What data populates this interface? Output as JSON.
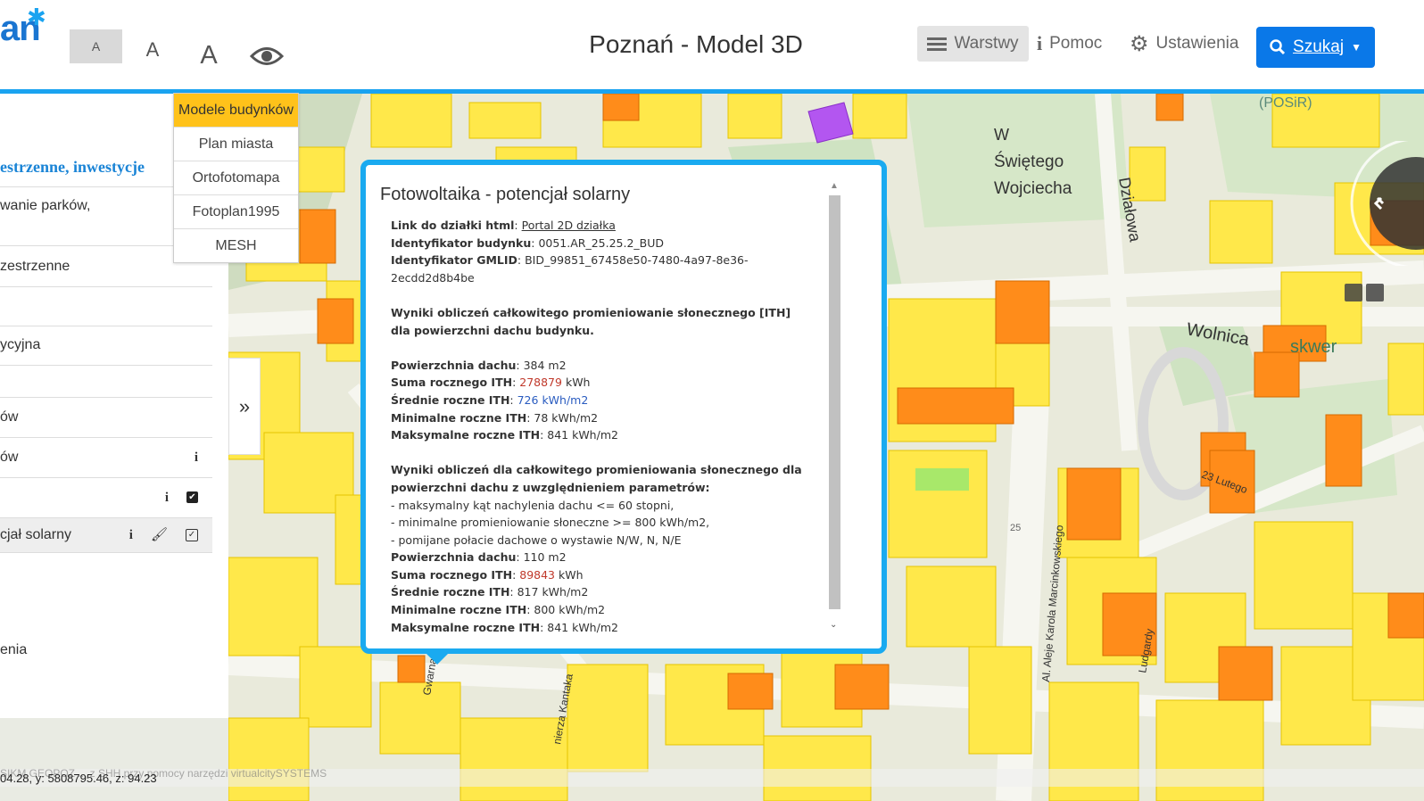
{
  "header": {
    "logo_text": "an",
    "font_small": "A",
    "font_medium": "A",
    "font_large": "A",
    "title": "Poznań - Model 3D",
    "layers_label": "Warstwy",
    "help_label": "Pomoc",
    "settings_label": "Ustawienia",
    "search_label": "Szukaj"
  },
  "colors": {
    "accent": "#1aa3f0",
    "search_button": "#0a78e8",
    "basemap_active": "#ffc21a",
    "building_yellow": "#ffe84a",
    "building_orange": "#ff8c1a"
  },
  "basemap_menu": {
    "items": [
      "Modele budynków",
      "Plan miasta",
      "Ortofotomapa",
      "Fotoplan1995",
      "MESH"
    ],
    "active": "Modele budynków"
  },
  "sidebar": {
    "section_title": "estrzenne, inwestycje",
    "items": [
      "wanie parków,",
      "zestrzenne",
      "ycyjna",
      "ów",
      "ów",
      "",
      "cjał solarny",
      "enia"
    ]
  },
  "map_labels": {
    "swietego": "Świętego",
    "wojciecha": "Wojciecha",
    "w": "W",
    "dzialowa": "Działowa",
    "wolnica": "Wolnica",
    "skwer": "skwer",
    "posir": "(POSiR)",
    "marcinkowskiego": "Al. Aleje Karola Marcinkowskiego",
    "kantaka": "nierza Kantaka",
    "lutego": "23 Lutego",
    "gwarna": "Gwarna",
    "ludgardy": "Ludgardy",
    "number_25": "25"
  },
  "popup": {
    "title": "Fotowoltaika - potencjał solarny",
    "link_label": "Link do działki html",
    "link_text": "Portal 2D działka",
    "building_id_label": "Identyfikator budynku",
    "building_id": "0051.AR_25.25.2_BUD",
    "gmlid_label": "Identyfikator GMLID",
    "gmlid_1": "BID_99851_67458e50-7480-4a97-8e36-",
    "gmlid_2": "2ecdd2d8b4be",
    "section1_line1": "Wyniki obliczeń całkowitego promieniowanie słonecznego [ITH]",
    "section1_line2": "dla powierzchni dachu budynku.",
    "roof_area_label": "Powierzchnia dachu",
    "roof_area_1": "384 m2",
    "annual_sum_label": "Suma rocznego ITH",
    "annual_sum_1": "278879",
    "kwh": "kWh",
    "avg_label": "Średnie roczne ITH",
    "avg_1": "726 kWh/m2",
    "min_label": "Minimalne roczne ITH",
    "min_1": "78 kWh/m2",
    "max_label": "Maksymalne roczne ITH",
    "max_1": "841 kWh/m2",
    "section2_line1": "Wyniki obliczeń dla całkowitego promieniowania słonecznego dla",
    "section2_line2": "powierzchni dachu z uwzględnieniem parametrów:",
    "param_1": "- maksymalny kąt nachylenia dachu <= 60 stopni,",
    "param_2": "- minimalne promieniowanie słoneczne >= 800 kWh/m2,",
    "param_3": "- pomijane połacie dachowe o wystawie N/W, N, N/E",
    "roof_area_2": "110 m2",
    "annual_sum_2": "89843",
    "avg_2": "817 kWh/m2",
    "min_2": "800 kWh/m2",
    "max_2": "841 kWh/m2"
  },
  "status": {
    "coords": "04.28, y: 5808795.46, z: 94.23",
    "credits": "SIKM GEOPOZ ... z SHH przy pomocy narzędzi virtualcitySYSTEMS"
  }
}
